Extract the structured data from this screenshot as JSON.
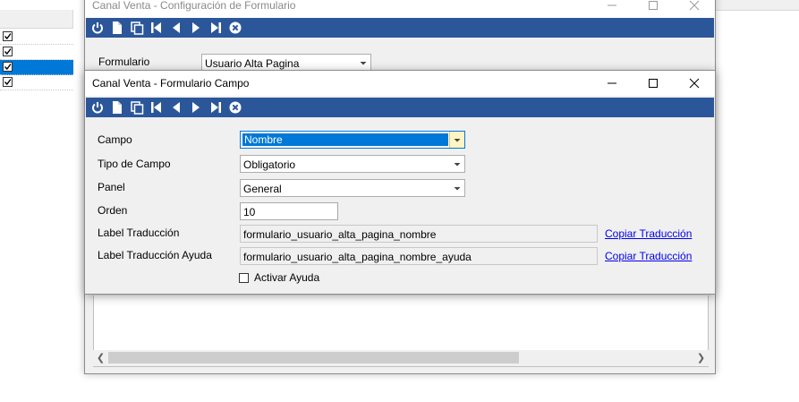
{
  "colors": {
    "toolbar": "#2b579a",
    "selection": "#0078d7",
    "link": "#0000ee"
  },
  "toolbar_icons": [
    "power-icon",
    "new-document-icon",
    "copy-icon",
    "first-record-icon",
    "previous-record-icon",
    "next-record-icon",
    "last-record-icon",
    "close-circle-icon"
  ],
  "background_window": {
    "title": "Canal Venta - Configuración de Formulario",
    "formulario_label": "Formulario",
    "formulario_value": "Usuario Alta Pagina"
  },
  "left_grid": {
    "rows": [
      {
        "checked": true
      },
      {
        "checked": true
      },
      {
        "checked": true,
        "selected": true
      },
      {
        "checked": true
      }
    ]
  },
  "dialog": {
    "title": "Canal Venta - Formulario Campo",
    "fields": {
      "campo": {
        "label": "Campo",
        "value": "Nombre"
      },
      "tipo_campo": {
        "label": "Tipo de Campo",
        "value": "Obligatorio"
      },
      "panel": {
        "label": "Panel",
        "value": "General"
      },
      "orden": {
        "label": "Orden",
        "value": "10"
      },
      "label_traduccion": {
        "label": "Label Traducción",
        "value": "formulario_usuario_alta_pagina_nombre",
        "link": "Copiar Traducción"
      },
      "label_traduccion_ayuda": {
        "label": "Label Traducción Ayuda",
        "value": "formulario_usuario_alta_pagina_nombre_ayuda",
        "link": "Copiar Traducción"
      }
    },
    "activar_ayuda": {
      "label": "Activar Ayuda",
      "checked": false
    }
  }
}
